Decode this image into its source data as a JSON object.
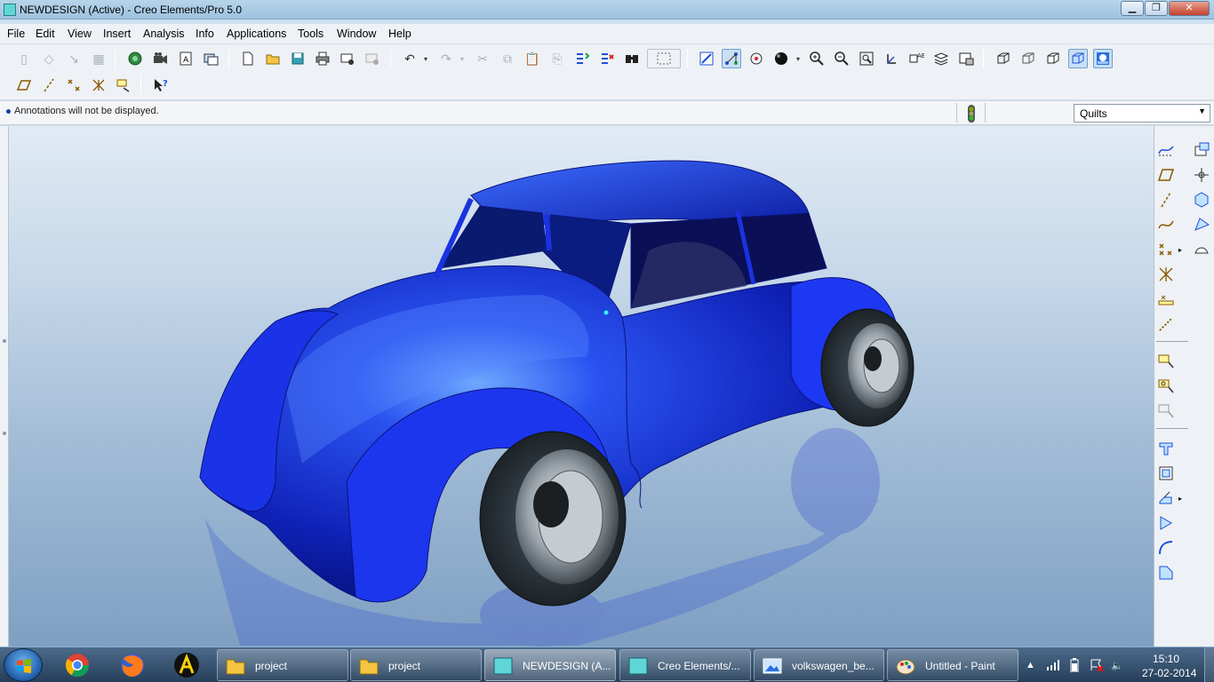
{
  "window": {
    "title": "NEWDESIGN (Active) - Creo Elements/Pro 5.0",
    "min_glyph": "▁",
    "max_glyph": "❐",
    "close_glyph": "✕"
  },
  "menu": {
    "items": [
      "File",
      "Edit",
      "View",
      "Insert",
      "Analysis",
      "Info",
      "Applications",
      "Tools",
      "Window",
      "Help"
    ]
  },
  "toolbar1": {
    "icons": [
      "cut-icon",
      "new-icon",
      "open-icon",
      "save-icon",
      "print-icon",
      "undo-icon",
      "redo-icon",
      "zoom-in-icon",
      "zoom-out-icon",
      "refit-icon",
      "repaint-icon",
      "datum-planes-icon",
      "datum-axes-icon",
      "datum-points-icon",
      "coordinate-systems-icon",
      "shading-icon",
      "wireframe-icon",
      "hidden-line-icon",
      "no-hidden-icon",
      "shaded-view-icon",
      "enhanced-realism-icon"
    ]
  },
  "message": {
    "text": "Annotations will not be displayed.",
    "status_light": "green"
  },
  "filter": {
    "value": "Quilts"
  },
  "model": {
    "name": "NEWDESIGN",
    "body_color": "#1a2fd6"
  },
  "taskbar": {
    "tasks": [
      {
        "label": "project",
        "icon": "folder-icon"
      },
      {
        "label": "project",
        "icon": "folder-icon"
      },
      {
        "label": "NEWDESIGN (A...",
        "icon": "creo-icon"
      },
      {
        "label": "Creo Elements/...",
        "icon": "creo-icon"
      },
      {
        "label": "volkswagen_be...",
        "icon": "image-viewer-icon"
      },
      {
        "label": "Untitled - Paint",
        "icon": "paint-icon"
      }
    ],
    "clock_time": "15:10",
    "clock_date": "27-02-2014"
  },
  "colors": {
    "accent": "#6e9fcf",
    "car_body": "#1a2fd6",
    "taskbar": "#263f5a"
  }
}
